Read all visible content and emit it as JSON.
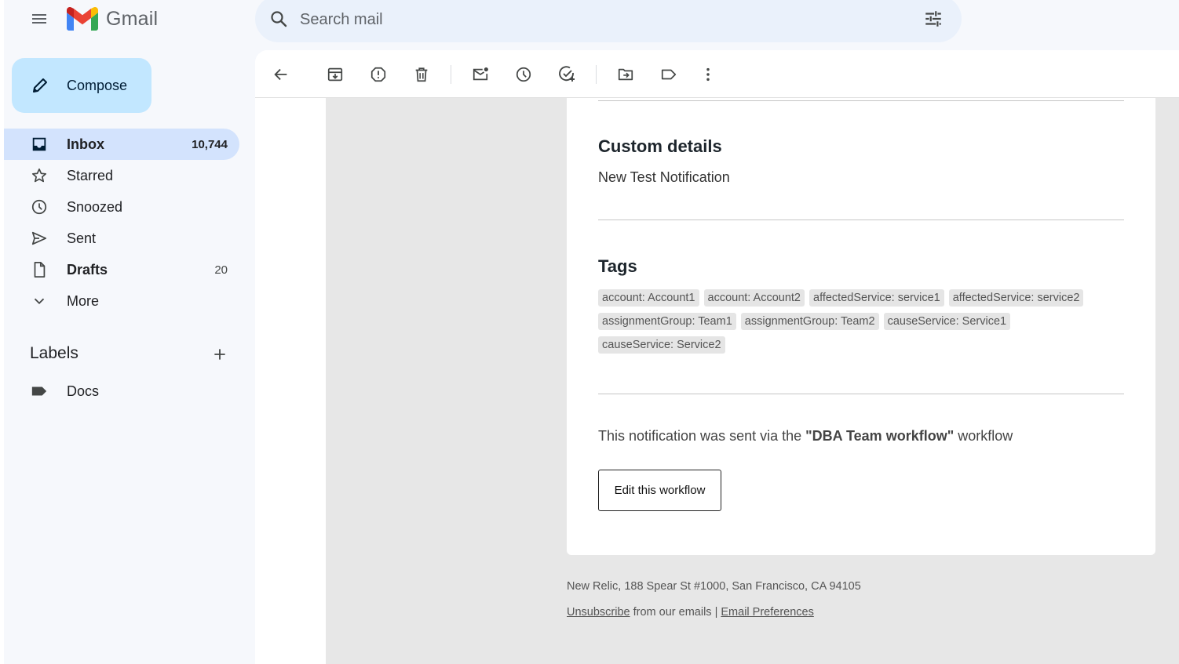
{
  "app": {
    "name": "Gmail"
  },
  "search": {
    "placeholder": "Search mail"
  },
  "sidebar": {
    "compose_label": "Compose",
    "items": [
      {
        "label": "Inbox",
        "count": "10,744",
        "icon": "inbox-icon"
      },
      {
        "label": "Starred",
        "count": "",
        "icon": "star-icon"
      },
      {
        "label": "Snoozed",
        "count": "",
        "icon": "clock-icon"
      },
      {
        "label": "Sent",
        "count": "",
        "icon": "send-icon"
      },
      {
        "label": "Drafts",
        "count": "20",
        "icon": "draft-icon"
      },
      {
        "label": "More",
        "count": "",
        "icon": "chevron-down-icon"
      }
    ],
    "labels_title": "Labels",
    "labels": [
      {
        "label": "Docs",
        "icon": "label-icon"
      }
    ]
  },
  "toolbar": {
    "icons": [
      "back-icon",
      "archive-icon",
      "report-spam-icon",
      "delete-icon",
      "mark-unread-icon",
      "snooze-icon",
      "add-to-tasks-icon",
      "move-to-icon",
      "labels-icon",
      "more-options-icon"
    ]
  },
  "email": {
    "custom_details_heading": "Custom details",
    "custom_details_text": "New Test Notification",
    "tags_heading": "Tags",
    "tags": [
      "account: Account1",
      "account: Account2",
      "affectedService: service1",
      "affectedService: service2",
      "assignmentGroup: Team1",
      "assignmentGroup: Team2",
      "causeService: Service1",
      "causeService: Service2"
    ],
    "workflow_note_prefix": "This notification was sent via the ",
    "workflow_name": "\"DBA Team workflow\"",
    "workflow_note_suffix": " workflow",
    "edit_button_label": "Edit this workflow",
    "footer_address": "New Relic, 188 Spear St #1000, San Francisco, CA 94105",
    "unsubscribe_label": "Unsubscribe",
    "footer_middle": " from our emails | ",
    "preferences_label": "Email Preferences"
  },
  "colors": {
    "app_background": "#f6f8fc",
    "compose_background": "#c2e7ff",
    "active_nav_background": "#d3e3fd",
    "search_background": "#eaf1fb",
    "email_frame_background": "#e7e7e7",
    "tag_background": "#e5e5e5"
  }
}
